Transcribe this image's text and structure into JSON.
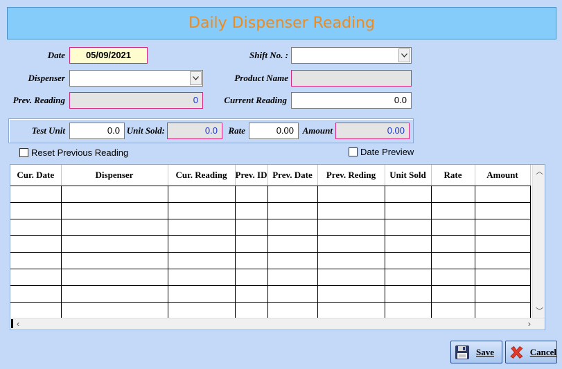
{
  "title": "Daily Dispenser Reading",
  "form": {
    "date_label": "Date",
    "date_value": "05/09/2021",
    "shift_label": "Shift No. :",
    "shift_value": "",
    "dispenser_label": "Dispenser",
    "dispenser_value": "",
    "product_label": "Product Name",
    "product_value": "",
    "prev_reading_label": "Prev. Reading",
    "prev_reading_value": "0",
    "current_reading_label": "Current Reading",
    "current_reading_value": "0.0"
  },
  "unit_panel": {
    "test_unit_label": "Test Unit",
    "test_unit_value": "0.0",
    "unit_sold_label": "Unit Sold:",
    "unit_sold_value": "0.0",
    "rate_label": "Rate",
    "rate_value": "0.00",
    "amount_label": "Amount",
    "amount_value": "0.00"
  },
  "options": {
    "reset_prev_label": "Reset Previous Reading",
    "reset_prev_checked": false,
    "date_preview_label": "Date Preview",
    "date_preview_checked": false
  },
  "grid": {
    "columns": [
      "Cur. Date",
      "Dispenser",
      "Cur. Reading",
      "Prev. ID",
      "Prev. Date",
      "Prev. Reding",
      "Unit Sold",
      "Rate",
      "Amount"
    ],
    "empty_rows": 8
  },
  "buttons": {
    "save_label": "Save",
    "cancel_label": "Cancel"
  },
  "colors": {
    "background": "#c4d9f7",
    "title_bar": "#85ccfb",
    "title_text": "#f08a1c",
    "required_border": "#d6287e",
    "date_field": "#fffdd0"
  }
}
